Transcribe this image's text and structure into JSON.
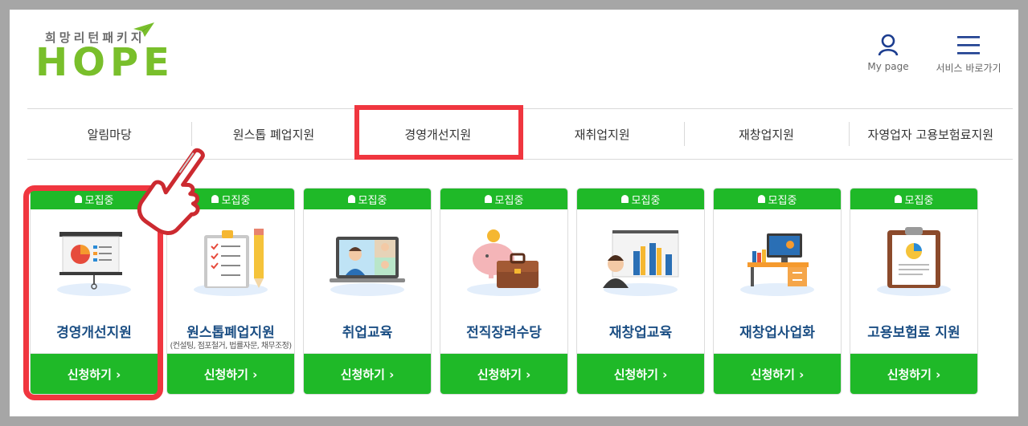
{
  "header": {
    "logo_sub": "희망리턴패키지",
    "logo_main": "HOPE",
    "mypage_label": "My page",
    "menu_label": "서비스 바로가기"
  },
  "nav": {
    "items": [
      {
        "label": "알림마당"
      },
      {
        "label": "원스톱 폐업지원"
      },
      {
        "label": "경영개선지원"
      },
      {
        "label": "재취업지원"
      },
      {
        "label": "재창업지원"
      },
      {
        "label": "자영업자 고용보험료지원"
      }
    ],
    "active_index": 2
  },
  "cards": [
    {
      "badge": "모집중",
      "title": "경영개선지원",
      "note": "",
      "apply": "신청하기 ›",
      "icon": "presentation-board-icon"
    },
    {
      "badge": "모집중",
      "title": "원스톱폐업지원",
      "note": "(컨설팅, 점포철거, 법률자문, 채무조정)",
      "apply": "신청하기 ›",
      "icon": "checklist-clipboard-icon"
    },
    {
      "badge": "모집중",
      "title": "취업교육",
      "note": "",
      "apply": "신청하기 ›",
      "icon": "video-meeting-laptop-icon"
    },
    {
      "badge": "모집중",
      "title": "전직장려수당",
      "note": "",
      "apply": "신청하기 ›",
      "icon": "piggy-bank-briefcase-icon"
    },
    {
      "badge": "모집중",
      "title": "재창업교육",
      "note": "",
      "apply": "신청하기 ›",
      "icon": "bar-chart-presenter-icon"
    },
    {
      "badge": "모집중",
      "title": "재창업사업화",
      "note": "",
      "apply": "신청하기 ›",
      "icon": "office-desk-monitor-icon"
    },
    {
      "badge": "모집중",
      "title": "고용보험료 지원",
      "note": "",
      "apply": "신청하기 ›",
      "icon": "document-clipboard-icon"
    }
  ],
  "colors": {
    "accent_green": "#1fb928",
    "logo_green": "#79bf2b",
    "title_blue": "#1c4f84",
    "highlight_red": "#f0363f"
  }
}
